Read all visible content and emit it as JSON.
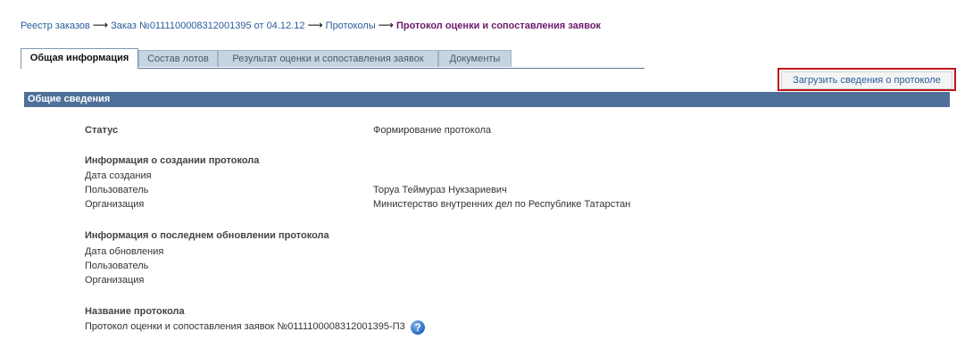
{
  "breadcrumb": {
    "items": [
      "Реестр заказов",
      "Заказ №0111100008312001395 от 04.12.12",
      "Протоколы"
    ],
    "current": "Протокол оценки и сопоставления заявок",
    "separator": "⟶"
  },
  "tabs": [
    {
      "label": "Общая информация",
      "active": true
    },
    {
      "label": "Состав лотов",
      "active": false
    },
    {
      "label": "Результат оценки и сопоставления заявок",
      "active": false
    },
    {
      "label": "Документы",
      "active": false
    }
  ],
  "upload_button": "Загрузить сведения о протоколе",
  "section_title": "Общие сведения",
  "status": {
    "label": "Статус",
    "value": "Формирование протокола"
  },
  "created": {
    "heading": "Информация о создании протокола",
    "date_label": "Дата создания",
    "user_label": "Пользователь",
    "user_value": "Торуа Теймураз Нукзариевич",
    "org_label": "Организация",
    "org_value": "Министерство внутренних дел по Республике Татарстан"
  },
  "updated": {
    "heading": "Информация о последнем обновлении протокола",
    "date_label": "Дата обновления",
    "user_label": "Пользователь",
    "org_label": "Организация"
  },
  "protocol_name": {
    "heading": "Название протокола",
    "value": "Протокол оценки и сопоставления заявок №0111100008312001395-П3"
  },
  "help_icon": "?",
  "colors": {
    "section_bar": "#4e6f98",
    "link": "#2b5d9c",
    "current_crumb": "#6b1a6b",
    "highlight_border": "#c0131b"
  }
}
